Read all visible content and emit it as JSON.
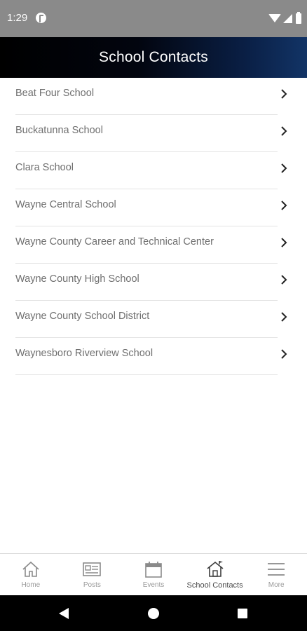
{
  "status_bar": {
    "time": "1:29"
  },
  "app_bar": {
    "title": "School Contacts"
  },
  "contacts": [
    {
      "name": "Beat Four School"
    },
    {
      "name": "Buckatunna School"
    },
    {
      "name": "Clara School"
    },
    {
      "name": "Wayne Central School"
    },
    {
      "name": "Wayne County Career and Technical Center"
    },
    {
      "name": "Wayne County High School"
    },
    {
      "name": "Wayne County School District"
    },
    {
      "name": "Waynesboro Riverview School"
    }
  ],
  "bottom_nav": {
    "items": [
      {
        "label": "Home",
        "icon": "home-icon"
      },
      {
        "label": "Posts",
        "icon": "newspaper-icon"
      },
      {
        "label": "Events",
        "icon": "calendar-icon"
      },
      {
        "label": "School Contacts",
        "icon": "school-icon",
        "active": true
      },
      {
        "label": "More",
        "icon": "menu-icon"
      }
    ]
  },
  "colors": {
    "status_bar": "#8a8a8a",
    "app_bar_start": "#000000",
    "app_bar_end": "#123466",
    "list_text": "#6f6f6f",
    "divider": "#e3e3e3",
    "nav_inactive": "#9a9a9a",
    "nav_active": "#4a4a4a"
  }
}
